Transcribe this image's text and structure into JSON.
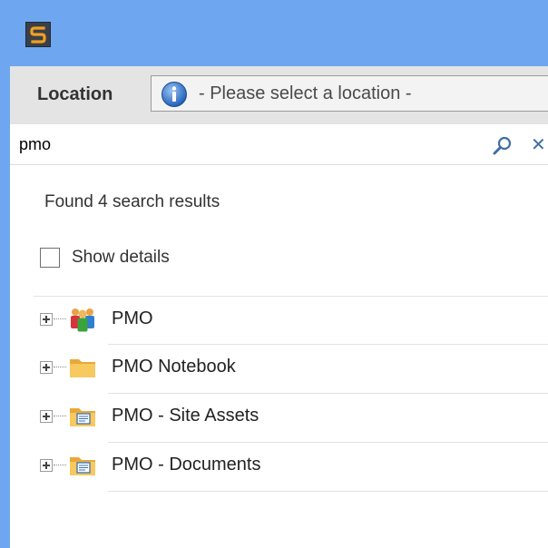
{
  "app": {
    "logo_icon": "app-logo-icon"
  },
  "location": {
    "label": "Location",
    "placeholder": "- Please select a location -",
    "icon": "info-icon"
  },
  "search": {
    "value": "pmo",
    "search_icon": "search-icon",
    "clear_icon": "close-icon"
  },
  "results": {
    "count_text": "Found 4 search results",
    "show_details_label": "Show details",
    "show_details_checked": false,
    "items": [
      {
        "label": "PMO",
        "icon": "people-group-icon"
      },
      {
        "label": "PMO Notebook",
        "icon": "folder-icon"
      },
      {
        "label": "PMO - Site Assets",
        "icon": "document-library-icon"
      },
      {
        "label": "PMO - Documents",
        "icon": "document-library-icon"
      }
    ]
  },
  "colors": {
    "titlebar": "#6ea6f0",
    "location_bar": "#e4e4e4",
    "accent": "#3f6fa8"
  }
}
